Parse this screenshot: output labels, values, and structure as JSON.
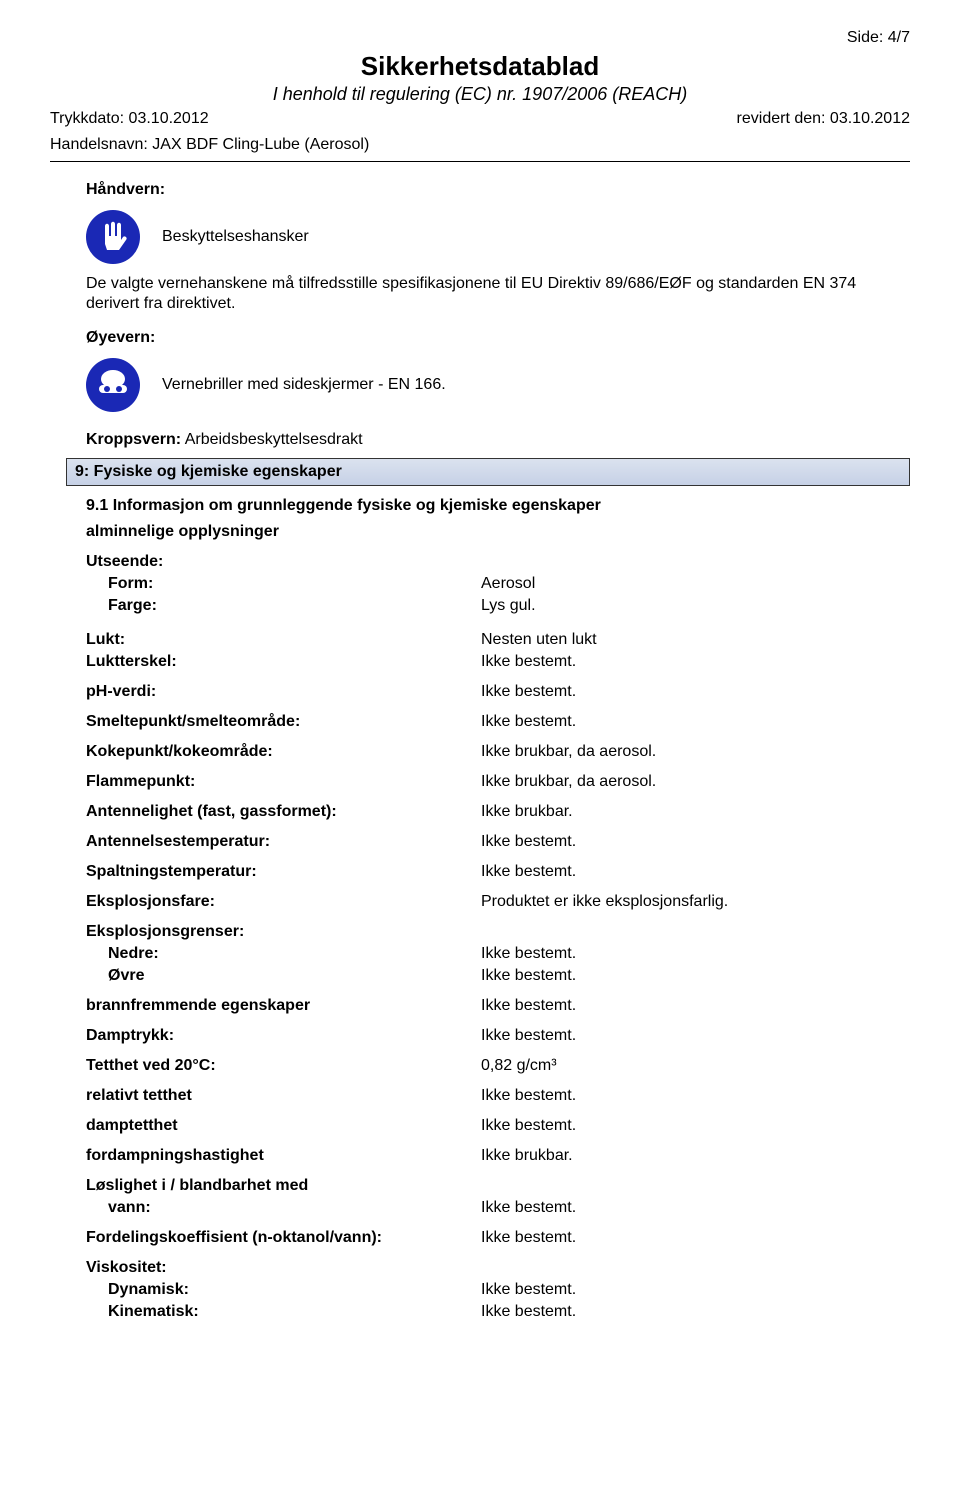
{
  "page": {
    "side_label": "Side: 4/7"
  },
  "header": {
    "title": "Sikkerhetsdatablad",
    "subtitle": "I henhold til regulering (EC) nr. 1907/2006 (REACH)",
    "print_date_label": "Trykkdato:",
    "print_date": "03.10.2012",
    "revised_label": "revidert den:",
    "revised_date": "03.10.2012",
    "trade_label": "Handelsnavn:",
    "trade_name": "JAX BDF Cling-Lube (Aerosol)"
  },
  "hand": {
    "label": "Håndvern:",
    "icon_caption": "Beskyttelseshansker",
    "text": "De valgte vernehanskene må tilfredsstille spesifikasjonene til EU Direktiv 89/686/EØF og standarden EN 374 derivert fra direktivet."
  },
  "eye": {
    "label": "Øyevern:",
    "icon_caption": "Vernebriller med sideskjermer - EN 166."
  },
  "body": {
    "label_inline": "Kroppsvern:",
    "value": "Arbeidsbeskyttelsesdrakt"
  },
  "section9": {
    "bar": "9: Fysiske og kjemiske egenskaper",
    "sub": "9.1 Informasjon om grunnleggende fysiske og kjemiske egenskaper",
    "general": "alminnelige opplysninger"
  },
  "appearance": {
    "head": "Utseende:",
    "form_key": "Form:",
    "form_val": "Aerosol",
    "color_key": "Farge:",
    "color_val": "Lys gul."
  },
  "props": {
    "lukt_key": "Lukt:",
    "lukt_val": "Nesten uten lukt",
    "luktterskel_key": "Luktterskel:",
    "luktterskel_val": "Ikke bestemt.",
    "ph_key": "pH-verdi:",
    "ph_val": "Ikke bestemt.",
    "smelt_key": "Smeltepunkt/smelteområde:",
    "smelt_val": "Ikke bestemt.",
    "koke_key": "Kokepunkt/kokeområde:",
    "koke_val": "Ikke brukbar, da aerosol.",
    "flamme_key": "Flammepunkt:",
    "flamme_val": "Ikke brukbar, da aerosol.",
    "antenn_key": "Antennelighet (fast, gassformet):",
    "antenn_val": "Ikke brukbar.",
    "antennelsestemp_key": "Antennelsestemperatur:",
    "antennelsestemp_val": "Ikke bestemt.",
    "spalt_key": "Spaltningstemperatur:",
    "spalt_val": "Ikke bestemt.",
    "eksplfare_key": "Eksplosjonsfare:",
    "eksplfare_val": "Produktet er ikke eksplosjonsfarlig.",
    "eksplgrenser_head": "Eksplosjonsgrenser:",
    "nedre_key": "Nedre:",
    "nedre_val": "Ikke bestemt.",
    "ovre_key": "Øvre",
    "ovre_val": "Ikke bestemt.",
    "brannfrem_key": "brannfremmende egenskaper",
    "brannfrem_val": "Ikke bestemt.",
    "damptrykk_key": "Damptrykk:",
    "damptrykk_val": "Ikke bestemt.",
    "tetthet_key": "Tetthet ved 20°C:",
    "tetthet_val": "0,82 g/cm³",
    "reltetthet_key": "relativt tetthet",
    "reltetthet_val": "Ikke bestemt.",
    "damptetthet_key": "damptetthet",
    "damptetthet_val": "Ikke bestemt.",
    "fordamp_key": "fordampningshastighet",
    "fordamp_val": "Ikke brukbar.",
    "loslighet_head": "Løslighet i / blandbarhet med",
    "vann_key": "vann:",
    "vann_val": "Ikke bestemt.",
    "fordkoef_key": "Fordelingskoeffisient (n-oktanol/vann):",
    "fordkoef_val": "Ikke bestemt.",
    "visk_head": "Viskositet:",
    "dyn_key": "Dynamisk:",
    "dyn_val": "Ikke bestemt.",
    "kin_key": "Kinematisk:",
    "kin_val": "Ikke bestemt."
  }
}
